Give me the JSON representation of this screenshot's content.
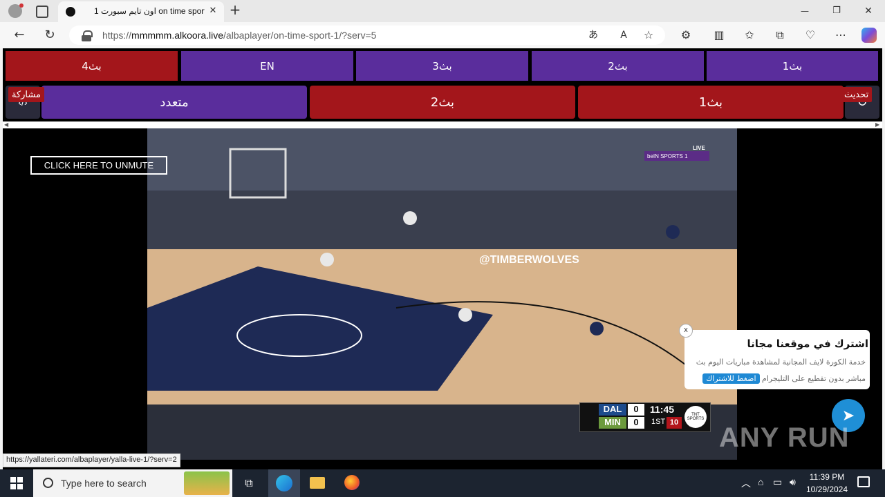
{
  "browser": {
    "tab_title": "اون تايم سبورت 1 on time sport 1",
    "new_tab": "+",
    "url_prefix": "https://",
    "url_host": "mmmmm.alkoora.live",
    "url_path": "/albaplayer/on-time-sport-1/?serv=5",
    "window_min": "—",
    "window_max": "❐",
    "window_close": "✕"
  },
  "servers": {
    "row1": [
      "بث4",
      "EN",
      "بث3",
      "بث2",
      "بث1"
    ],
    "row2": [
      "متعدد",
      "بث2",
      "بث1"
    ],
    "share_label": "مشاركة",
    "refresh_label": "تحديث"
  },
  "player": {
    "unmute_label": "CLICK HERE TO UNMUTE",
    "network_badge": "beIN SPORTS 1",
    "live_label": "LIVE",
    "scoreboard": {
      "team1": "DAL",
      "score1": "0",
      "team2": "MIN",
      "score2": "0",
      "clock": "11:45",
      "period": "1ST",
      "shot_clock": "10",
      "broadcaster": "TNT SPORTS"
    }
  },
  "popup": {
    "close": "x",
    "title": "اشترك في موقعنا مجانا",
    "body": "خدمة الكورة لايف المجانية لمشاهدة مباريات اليوم بث مباشر بدون تقطيع على التليجرام",
    "button": "اضغط للاشتراك"
  },
  "status_url": "https://yallateri.com/albaplayer/yalla-live-1/?serv=2",
  "watermark": "ANY RUN",
  "taskbar": {
    "search_placeholder": "Type here to search",
    "time": "11:39 PM",
    "date": "10/29/2024"
  },
  "colors": {
    "purple": "#5a2d9c",
    "red": "#a3161b",
    "telegram": "#1f8fd6"
  }
}
